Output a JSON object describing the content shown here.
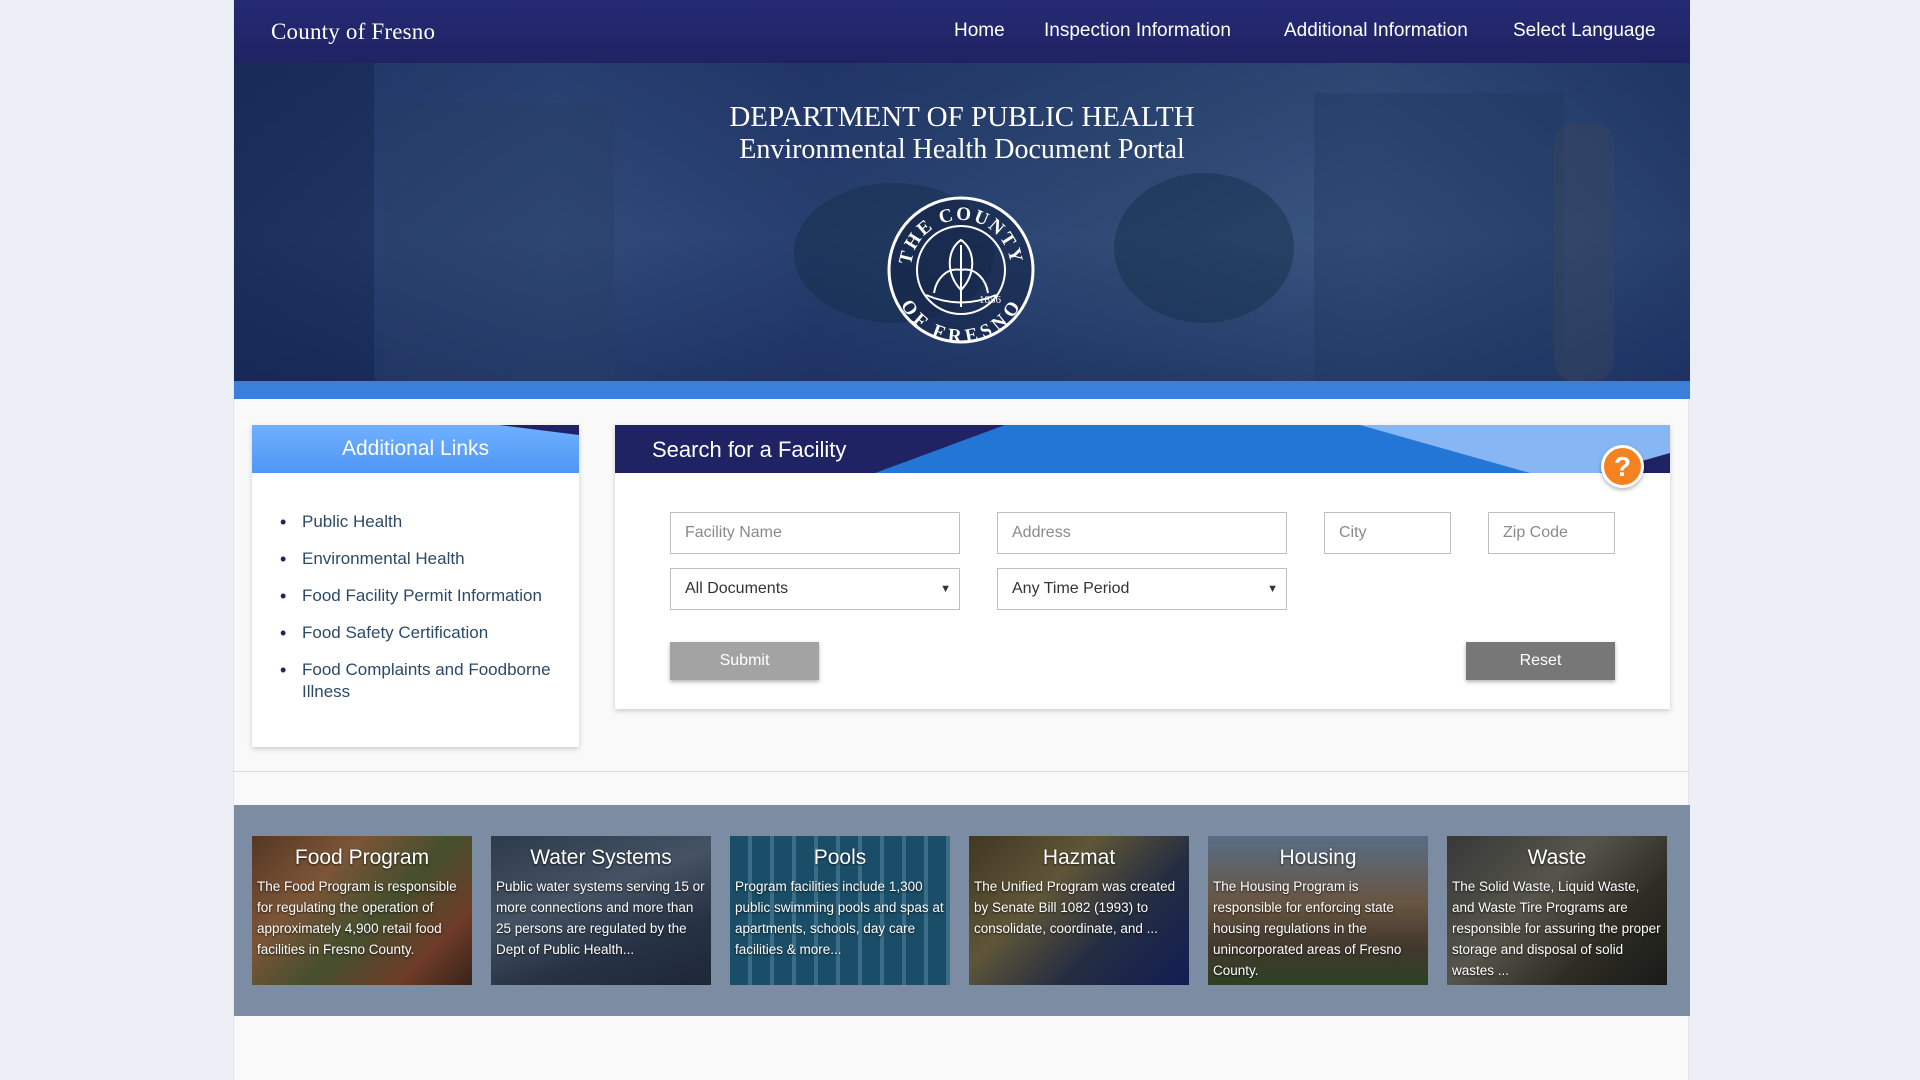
{
  "nav": {
    "brand": "County of Fresno",
    "links": [
      "Home",
      "Inspection Information",
      "Additional Information",
      "Select Language"
    ]
  },
  "hero": {
    "title": "DEPARTMENT OF PUBLIC HEALTH",
    "subtitle": "Environmental Health Document Portal",
    "seal": {
      "top_text": "THE COUNTY",
      "bottom_text": "OF FRESNO",
      "year": "1856"
    }
  },
  "links_panel": {
    "title": "Additional Links",
    "items": [
      "Public Health",
      "Environmental Health",
      "Food Facility Permit Information",
      "Food Safety Certification",
      "Food Complaints and Foodborne Illness"
    ]
  },
  "search": {
    "title": "Search for a Facility",
    "help_icon": "?",
    "facility_placeholder": "Facility Name",
    "address_placeholder": "Address",
    "city_placeholder": "City",
    "zip_placeholder": "Zip Code",
    "documents_value": "All Documents",
    "period_value": "Any Time Period",
    "submit_label": "Submit",
    "reset_label": "Reset"
  },
  "programs": [
    {
      "title": "Food Program",
      "desc": "The Food Program is responsible for regulating the operation of approximately 4,900 retail food facilities in Fresno County."
    },
    {
      "title": "Water Systems",
      "desc": "Public water systems serving 15 or more connections and more than 25 persons are regulated by the Dept of Public Health..."
    },
    {
      "title": "Pools",
      "desc": "Program facilities include 1,300 public swimming pools and spas at apartments, schools, day care facilities & more..."
    },
    {
      "title": "Hazmat",
      "desc": "The Unified Program was created by Senate Bill 1082 (1993) to consolidate, coordinate, and ..."
    },
    {
      "title": "Housing",
      "desc": "The Housing Program is responsible for enforcing state housing regulations in the unincorporated areas of Fresno County."
    },
    {
      "title": "Waste",
      "desc": "The Solid Waste, Liquid Waste, and Waste Tire Programs are responsible for assuring the proper storage and disposal of solid wastes ..."
    }
  ],
  "colors": {
    "nav_bg": "#1f2363",
    "accent_blue": "#3a7fdb",
    "help_orange": "#f58220",
    "programs_band": "#7c8da3",
    "submit_bg": "#a3a3a3",
    "reset_bg": "#777777"
  }
}
